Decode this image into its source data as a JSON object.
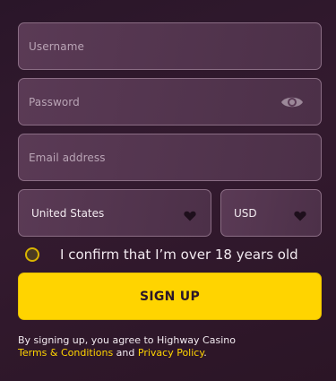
{
  "form": {
    "username_placeholder": "Username",
    "password_placeholder": "Password",
    "email_placeholder": "Email address",
    "country_value": "United States",
    "currency_value": "USD"
  },
  "confirm": {
    "label": "I confirm that I’m over 18 years old",
    "checked": false
  },
  "signup_button": {
    "label": "SIGN UP"
  },
  "terms": {
    "prefix": "By signing up, you agree to Highway Casino",
    "terms_link": "Terms & Conditions",
    "and_text": " and ",
    "privacy_link": "Privacy Policy",
    "suffix": "."
  },
  "icons": {
    "password_toggle": "eye-icon",
    "dropdown": "heart-icon"
  },
  "colors": {
    "accent": "#ffd400",
    "background": "#2e1a2c",
    "field_fill": "#533650",
    "field_border": "#8a6d84"
  }
}
